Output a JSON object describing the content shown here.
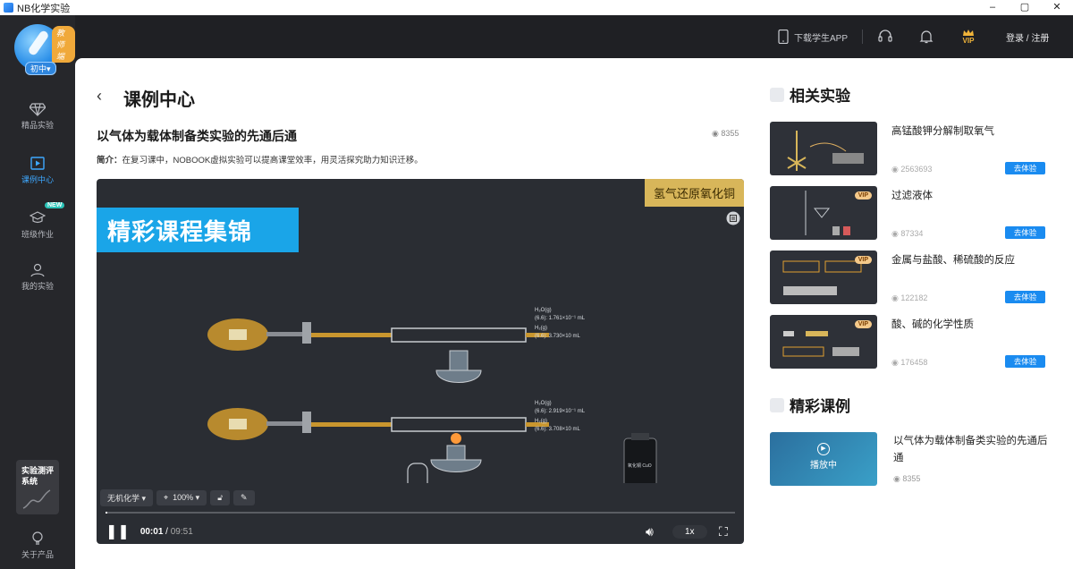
{
  "window": {
    "title": "NB化学实验",
    "controls": [
      "–",
      "▢",
      "✕"
    ]
  },
  "sidebar": {
    "badge": "教师端",
    "grade": "初中▾",
    "items": [
      {
        "label": "精品实验",
        "icon": "diamond-icon"
      },
      {
        "label": "课例中心",
        "icon": "video-icon",
        "active": true
      },
      {
        "label": "班级作业",
        "icon": "graduation-cap-icon",
        "badge": "NEW"
      },
      {
        "label": "我的实验",
        "icon": "user-icon"
      }
    ],
    "eval_card": "实验测评系统",
    "about": "关于产品"
  },
  "header": {
    "download": "下载学生APP",
    "vip": "VIP",
    "login": "登录 / 注册"
  },
  "main": {
    "back": "‹",
    "page_title": "课例中心",
    "experiment_title": "以气体为载体制备类实验的先通后通",
    "views": "8355",
    "intro_label": "简介：",
    "intro_text": "在复习课中，NOBOOK虚拟实验可以提高课堂效率，用灵活探究助力知识迁移。"
  },
  "video": {
    "banner": "精彩课程集锦",
    "topic": "氢气还原氧化铜",
    "subject": "无机化学",
    "zoom": "100%",
    "time_current": "00:01",
    "time_total": "09:51",
    "speed": "1x",
    "progress": 0.002,
    "labels_top": [
      "H₂O(g)",
      "(6.6): 1.761×10⁻¹ mL",
      "H₂(g)",
      "(6.6): 3.730×10 mL"
    ],
    "labels_bottom": [
      "H₂O(g)",
      "(6.6): 2.919×10⁻¹ mL",
      "H₂(g)",
      "(6.6): 3.708×10 mL"
    ],
    "bottle_label": "氧化铜 CuO"
  },
  "related": {
    "title": "相关实验",
    "button_label": "去体验",
    "items": [
      {
        "name": "高锰酸钾分解制取氧气",
        "views": "2563693",
        "vip": false
      },
      {
        "name": "过滤液体",
        "views": "87334",
        "vip": true
      },
      {
        "name": "金属与盐酸、稀硫酸的反应",
        "views": "122182",
        "vip": true
      },
      {
        "name": "酸、碱的化学性质",
        "views": "176458",
        "vip": true
      }
    ]
  },
  "featured": {
    "title": "精彩课例",
    "item_title": "以气体为载体制备类实验的先通后通",
    "playing": "播放中",
    "views": "8355"
  },
  "colors": {
    "accent": "#1a8bf0",
    "sidebar_bg": "#26272b",
    "banner": "#1aa5e8",
    "topic_tag": "#d8b65a"
  }
}
